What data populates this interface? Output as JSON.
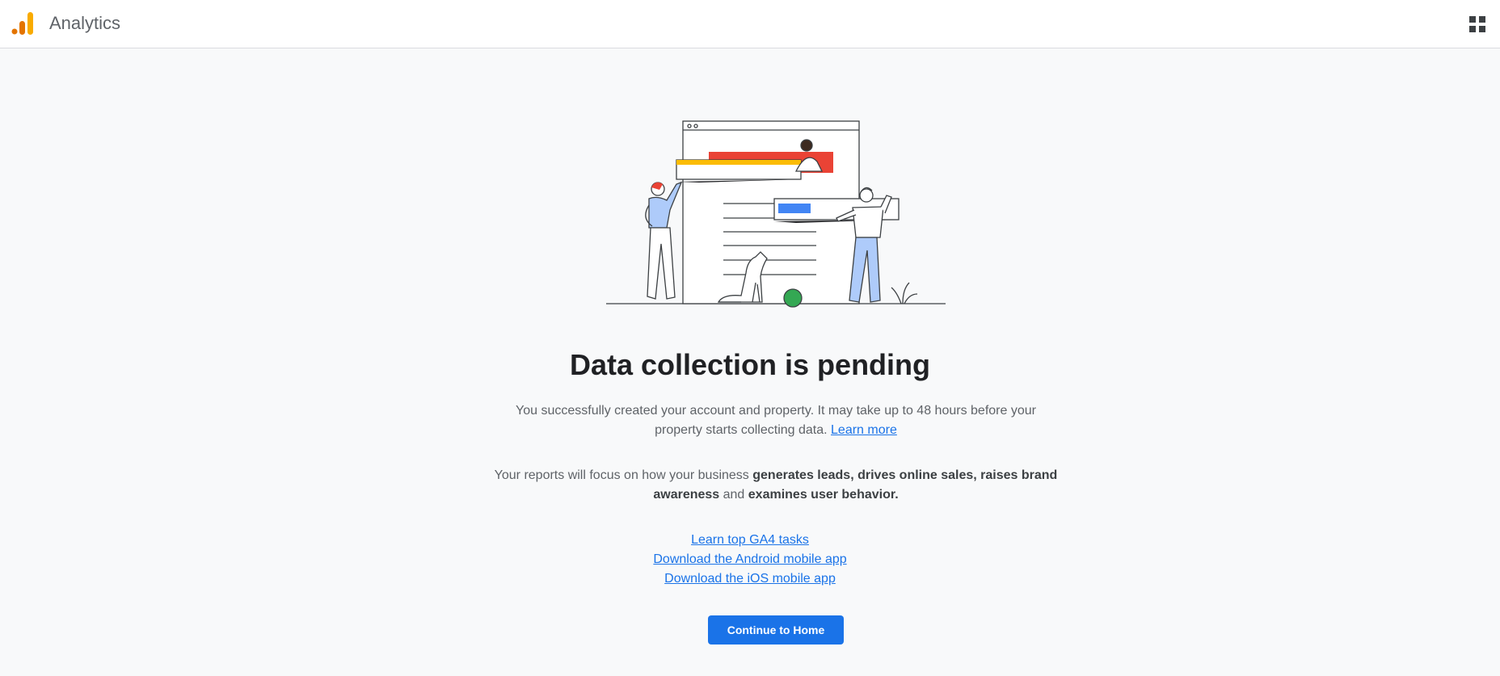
{
  "header": {
    "app_title": "Analytics",
    "logo_icon": "analytics-logo-icon",
    "apps_icon": "apps-grid-icon"
  },
  "main": {
    "illustration_icon": "data-collection-illustration",
    "headline": "Data collection is pending",
    "para1_text": "You successfully created your account and property. It may take up to 48 hours before your property starts collecting data.",
    "para1_link": "Learn more",
    "para2": {
      "t1": "Your reports will focus on how your business ",
      "b1": "generates leads, drives online sales, raises brand awareness",
      "t2": " and ",
      "b2": "examines user behavior."
    },
    "links": [
      "Learn top GA4 tasks",
      "Download the Android mobile app",
      "Download the iOS mobile app"
    ],
    "continue_label": "Continue to Home"
  },
  "colors": {
    "primary_blue": "#1a73e8",
    "logo_orange": "#f9ab00",
    "logo_dark_orange": "#e37400",
    "background": "#f8f9fa"
  }
}
